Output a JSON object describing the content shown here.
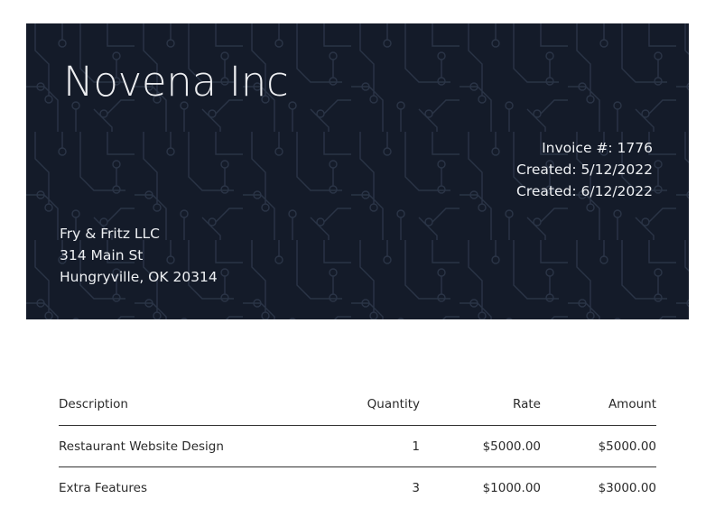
{
  "invoice": {
    "company_name": "Novena Inc",
    "meta": {
      "invoice_number": "Invoice #: 1776",
      "created": "Created: 5/12/2022",
      "due": "Created: 6/12/2022"
    },
    "client": {
      "name": "Fry & Fritz LLC",
      "street": "314 Main St",
      "city": "Hungryville, OK 20314"
    },
    "colors": {
      "banner_background": "#141b29",
      "banner_pattern": "#2a3446",
      "banner_text": "#eef0f3"
    },
    "table": {
      "headers": {
        "description": "Description",
        "quantity": "Quantity",
        "rate": "Rate",
        "amount": "Amount"
      },
      "rows": [
        {
          "description": "Restaurant Website Design",
          "quantity": "1",
          "rate": "$5000.00",
          "amount": "$5000.00"
        },
        {
          "description": "Extra Features",
          "quantity": "3",
          "rate": "$1000.00",
          "amount": "$3000.00"
        }
      ]
    }
  }
}
